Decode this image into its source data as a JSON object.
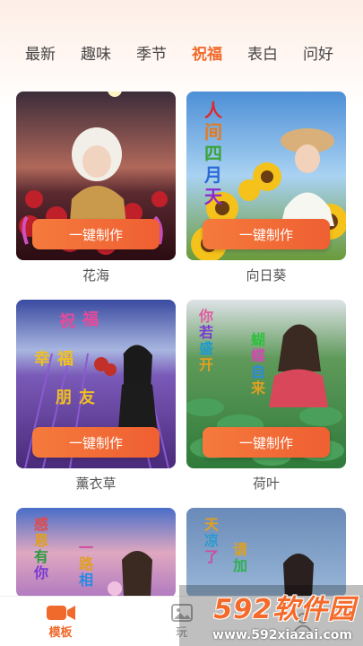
{
  "tabs": [
    "最新",
    "趣味",
    "季节",
    "祝福",
    "表白",
    "问好"
  ],
  "active_tab": "祝福",
  "make_button_label": "一键制作",
  "cards": [
    {
      "caption": "花海",
      "overlay": []
    },
    {
      "caption": "向日葵",
      "overlay": [
        "人间四月天"
      ]
    },
    {
      "caption": "薰衣草",
      "overlay": [
        "祝福",
        "幸福",
        "朋友"
      ]
    },
    {
      "caption": "荷叶",
      "overlay": [
        "你若盛开",
        "蝴蝶自来"
      ]
    },
    {
      "caption": "",
      "overlay": [
        "感恩有你",
        "一路相"
      ]
    },
    {
      "caption": "",
      "overlay": [
        "天凉了",
        "请加"
      ]
    }
  ],
  "bottom_nav": [
    {
      "label": "模板",
      "icon": "video-camera-icon",
      "active": true
    },
    {
      "label": "玩",
      "icon": "image-icon",
      "active": false
    },
    {
      "label": "",
      "icon": "user-icon",
      "active": false
    }
  ],
  "watermark": {
    "logo": "592软件园",
    "url": "www.592xiazai.com"
  },
  "colors": {
    "accent": "#f06a2c",
    "button": "#ef5f32"
  }
}
